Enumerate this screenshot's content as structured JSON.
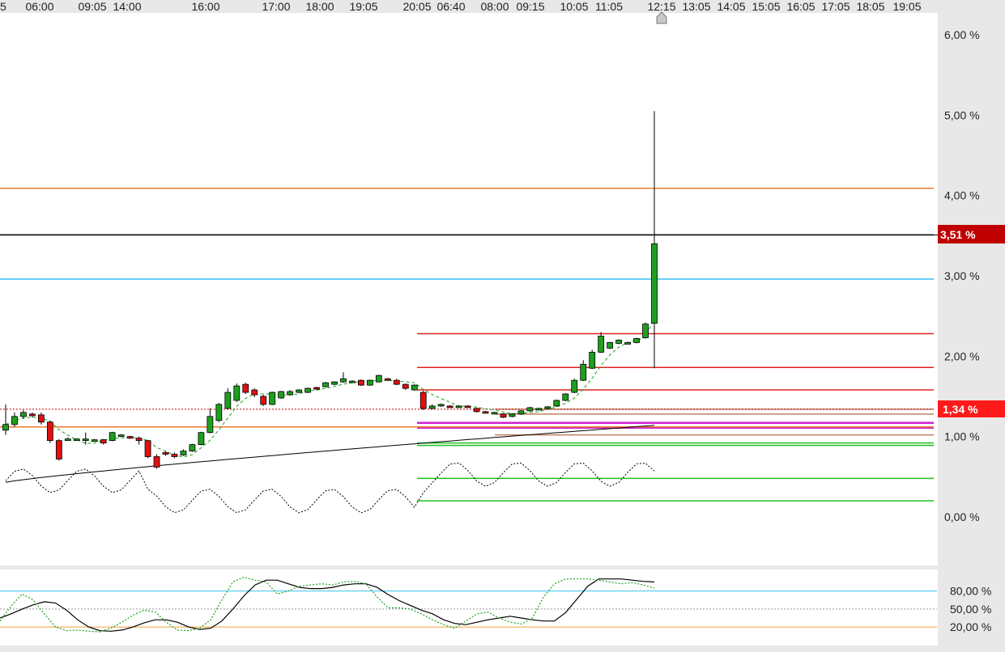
{
  "chart_data": [
    {
      "type": "candlestick",
      "title": "",
      "x_tick_labels": [
        "5",
        "06:00",
        "09:05",
        "14:00",
        "16:00",
        "17:00",
        "18:00",
        "19:05",
        "20:05",
        "06:40",
        "08:00",
        "09:15",
        "10:05",
        "11:05",
        "12:15",
        "13:05",
        "14:05",
        "15:05",
        "16:05",
        "17:05",
        "18:05",
        "19:05"
      ],
      "current_time_marker": "12:15",
      "y_tick_labels": [
        "6,00 %",
        "5,00 %",
        "4,00 %",
        "3,00 %",
        "2,00 %",
        "1,00 %",
        "0,00 %"
      ],
      "y_ticks": [
        6,
        5,
        4,
        3,
        2,
        1,
        0
      ],
      "ylim": [
        -0.6,
        6.4
      ],
      "grid": false,
      "current_value_badge": "3,51 %",
      "current_value": 3.51,
      "marker_value_badge": "1,34 %",
      "marker_value": 1.34,
      "candles": [
        [
          1.08,
          1.15,
          1.02,
          1.4
        ],
        [
          1.15,
          1.25,
          1.12,
          1.3
        ],
        [
          1.25,
          1.3,
          1.22,
          1.33
        ],
        [
          1.28,
          1.27,
          1.24,
          1.3
        ],
        [
          1.27,
          1.18,
          1.15,
          1.3
        ],
        [
          1.18,
          0.95,
          0.92,
          1.2
        ],
        [
          0.95,
          0.72,
          0.7,
          0.97
        ],
        [
          0.97,
          0.97,
          0.95,
          0.99
        ],
        [
          0.97,
          0.97,
          0.96,
          0.98
        ],
        [
          0.97,
          0.97,
          0.9,
          1.05
        ],
        [
          0.96,
          0.96,
          0.95,
          0.97
        ],
        [
          0.96,
          0.92,
          0.9,
          0.97
        ],
        [
          0.95,
          1.05,
          0.94,
          1.06
        ],
        [
          1.02,
          1.02,
          1.0,
          1.03
        ],
        [
          1.0,
          0.98,
          0.97,
          1.01
        ],
        [
          0.98,
          0.95,
          0.9,
          1.0
        ],
        [
          0.95,
          0.75,
          0.73,
          0.96
        ],
        [
          0.75,
          0.62,
          0.6,
          0.78
        ],
        [
          0.8,
          0.78,
          0.76,
          0.82
        ],
        [
          0.78,
          0.75,
          0.73,
          0.8
        ],
        [
          0.77,
          0.82,
          0.76,
          0.84
        ],
        [
          0.82,
          0.9,
          0.81,
          0.91
        ],
        [
          0.9,
          1.05,
          0.89,
          1.06
        ],
        [
          1.05,
          1.25,
          1.04,
          1.35
        ],
        [
          1.2,
          1.4,
          1.18,
          1.42
        ],
        [
          1.35,
          1.55,
          1.34,
          1.6
        ],
        [
          1.45,
          1.63,
          1.43,
          1.66
        ],
        [
          1.65,
          1.55,
          1.53,
          1.67
        ],
        [
          1.58,
          1.52,
          1.49,
          1.6
        ],
        [
          1.5,
          1.4,
          1.38,
          1.52
        ],
        [
          1.4,
          1.55,
          1.39,
          1.56
        ],
        [
          1.48,
          1.56,
          1.47,
          1.57
        ],
        [
          1.52,
          1.56,
          1.51,
          1.58
        ],
        [
          1.55,
          1.58,
          1.54,
          1.59
        ],
        [
          1.55,
          1.6,
          1.54,
          1.61
        ],
        [
          1.61,
          1.59,
          1.58,
          1.62
        ],
        [
          1.62,
          1.67,
          1.61,
          1.68
        ],
        [
          1.65,
          1.68,
          1.64,
          1.69
        ],
        [
          1.68,
          1.72,
          1.67,
          1.8
        ],
        [
          1.68,
          1.69,
          1.67,
          1.7
        ],
        [
          1.7,
          1.64,
          1.63,
          1.71
        ],
        [
          1.64,
          1.7,
          1.63,
          1.71
        ],
        [
          1.68,
          1.76,
          1.67,
          1.77
        ],
        [
          1.72,
          1.7,
          1.69,
          1.73
        ],
        [
          1.7,
          1.65,
          1.64,
          1.72
        ],
        [
          1.65,
          1.6,
          1.58,
          1.66
        ],
        [
          1.58,
          1.64,
          1.57,
          1.65
        ],
        [
          1.55,
          1.35,
          1.33,
          1.57
        ],
        [
          1.35,
          1.38,
          1.34,
          1.4
        ],
        [
          1.38,
          1.4,
          1.37,
          1.41
        ],
        [
          1.38,
          1.37,
          1.36,
          1.39
        ],
        [
          1.37,
          1.38,
          1.36,
          1.39
        ],
        [
          1.38,
          1.37,
          1.36,
          1.39
        ],
        [
          1.35,
          1.31,
          1.3,
          1.36
        ],
        [
          1.31,
          1.3,
          1.29,
          1.32
        ],
        [
          1.3,
          1.3,
          1.29,
          1.31
        ],
        [
          1.28,
          1.24,
          1.23,
          1.29
        ],
        [
          1.25,
          1.28,
          1.24,
          1.29
        ],
        [
          1.28,
          1.32,
          1.27,
          1.33
        ],
        [
          1.32,
          1.36,
          1.31,
          1.37
        ],
        [
          1.35,
          1.35,
          1.34,
          1.36
        ],
        [
          1.35,
          1.37,
          1.34,
          1.38
        ],
        [
          1.38,
          1.45,
          1.37,
          1.46
        ],
        [
          1.45,
          1.53,
          1.44,
          1.54
        ],
        [
          1.55,
          1.7,
          1.54,
          1.72
        ],
        [
          1.7,
          1.9,
          1.69,
          1.95
        ],
        [
          1.85,
          2.05,
          1.84,
          2.08
        ],
        [
          2.05,
          2.25,
          2.04,
          2.3
        ],
        [
          2.1,
          2.17,
          2.09,
          2.18
        ],
        [
          2.16,
          2.2,
          2.15,
          2.21
        ],
        [
          2.16,
          2.17,
          2.15,
          2.18
        ],
        [
          2.17,
          2.22,
          2.16,
          2.23
        ],
        [
          2.23,
          2.4,
          2.22,
          2.42
        ],
        [
          2.41,
          3.4,
          1.85,
          5.05
        ]
      ],
      "horizontal_levels": [
        {
          "value": 4.09,
          "color": "#f07830",
          "from": "start"
        },
        {
          "value": 3.51,
          "color": "#000000",
          "from": "start"
        },
        {
          "value": 2.96,
          "color": "#38c0f0",
          "from": "start"
        },
        {
          "value": 2.28,
          "color": "#e02020",
          "from": "20:05"
        },
        {
          "value": 1.86,
          "color": "#e02020",
          "from": "20:05"
        },
        {
          "value": 1.58,
          "color": "#e02020",
          "from": "20:05"
        },
        {
          "value": 1.34,
          "color": "#c08060",
          "from": "08:00"
        },
        {
          "value": 1.28,
          "color": "#c08060",
          "from": "08:00"
        },
        {
          "value": 1.17,
          "color": "#d020d0",
          "from": "20:05"
        },
        {
          "value": 1.11,
          "color": "#d020d0",
          "from": "20:05"
        },
        {
          "value": 1.02,
          "color": "#c08060",
          "from": "08:00"
        },
        {
          "value": 0.92,
          "color": "#20c020",
          "from": "20:05"
        },
        {
          "value": 0.89,
          "color": "#20c020",
          "from": "20:05"
        },
        {
          "value": 0.48,
          "color": "#20c020",
          "from": "20:05"
        },
        {
          "value": 0.2,
          "color": "#20c020",
          "from": "20:05"
        },
        {
          "value": 1.12,
          "color": "#f07830",
          "from": "start"
        }
      ],
      "colors": {
        "up": "#1ea01e",
        "down": "#e01010",
        "badge_current": "#c00000",
        "badge_marker": "#ff1a1a"
      }
    },
    {
      "type": "line",
      "title": "",
      "y_tick_labels": [
        "80,00 %",
        "50,00 %",
        "20,00 %"
      ],
      "y_ticks": [
        80,
        50,
        20
      ],
      "ylim": [
        0,
        105
      ],
      "reference_lines": [
        {
          "value": 80,
          "color": "#38c0f0"
        },
        {
          "value": 50,
          "color": "#999999"
        },
        {
          "value": 20,
          "color": "#f0a030"
        }
      ],
      "series": [
        {
          "style": "solid",
          "color": "#000000",
          "values": [
            35,
            42,
            50,
            57,
            62,
            60,
            48,
            32,
            20,
            14,
            13,
            15,
            20,
            27,
            32,
            32,
            28,
            20,
            16,
            18,
            30,
            50,
            72,
            90,
            98,
            98,
            92,
            86,
            84,
            84,
            86,
            90,
            92,
            92,
            86,
            74,
            64,
            56,
            48,
            42,
            32,
            26,
            24,
            28,
            32,
            35,
            38,
            35,
            32,
            30,
            30,
            44,
            66,
            88,
            100,
            100,
            100,
            98,
            96,
            95
          ]
        },
        {
          "style": "dotted",
          "color": "#1ea01e",
          "values": [
            30,
            55,
            75,
            65,
            42,
            20,
            14,
            15,
            13,
            12,
            18,
            28,
            40,
            48,
            45,
            28,
            15,
            14,
            18,
            32,
            65,
            95,
            103,
            98,
            95,
            75,
            80,
            88,
            90,
            92,
            90,
            95,
            96,
            92,
            70,
            52,
            52,
            50,
            42,
            32,
            24,
            18,
            30,
            42,
            45,
            35,
            28,
            25,
            35,
            70,
            92,
            100,
            100,
            100,
            98,
            95,
            92,
            94,
            90,
            85
          ]
        }
      ]
    }
  ]
}
